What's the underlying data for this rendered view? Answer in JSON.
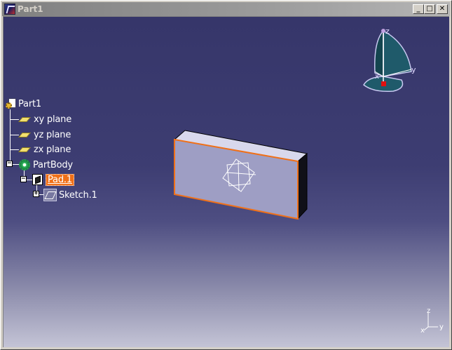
{
  "window": {
    "title": "Part1",
    "controls": {
      "minimize": "_",
      "maximize": "□",
      "close": "✕"
    }
  },
  "tree": {
    "root": {
      "label": "Part1",
      "icon": "part-icon"
    },
    "planes": [
      {
        "label": "xy plane",
        "icon": "plane-icon"
      },
      {
        "label": "yz plane",
        "icon": "plane-icon"
      },
      {
        "label": "zx plane",
        "icon": "plane-icon"
      }
    ],
    "body": {
      "label": "PartBody",
      "icon": "body-icon",
      "expander": "−"
    },
    "pad": {
      "label": "Pad.1",
      "icon": "pad-icon",
      "selected": true,
      "expander": "−"
    },
    "sketch": {
      "label": "Sketch.1",
      "icon": "sketch-icon",
      "expander": "+"
    }
  },
  "compass": {
    "z_label": "z",
    "y_label": "y",
    "x_label": "x"
  },
  "axis_indicator": {
    "z_label": "z",
    "y_label": "y",
    "x_label": "x"
  },
  "colors": {
    "selection": "#f07018",
    "part_face": "#a0a0c8",
    "part_edge": "#f07018",
    "background_top": "#36366a",
    "background_bottom": "#c4c4d6"
  }
}
